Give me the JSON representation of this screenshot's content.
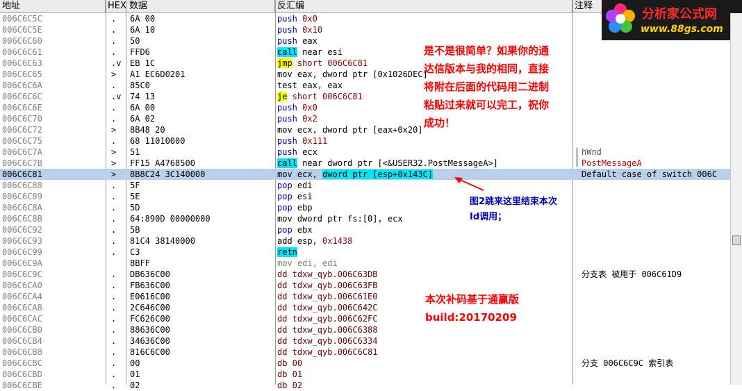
{
  "header": {
    "addr": "地址",
    "hex": "HEX 数据",
    "disasm": "反汇编",
    "comment": "注释"
  },
  "logo": {
    "title": "分析家公式网",
    "url": "www.88gs.com"
  },
  "rows": [
    {
      "addr": "006C6C5C",
      "mark": ".",
      "hex": "6A 00",
      "dis": [
        {
          "t": "push",
          "c": "kw-push"
        },
        {
          "t": " "
        },
        {
          "t": "0x0",
          "c": "imm"
        }
      ],
      "cmt": ""
    },
    {
      "addr": "006C6C5E",
      "mark": ".",
      "hex": "6A 10",
      "dis": [
        {
          "t": "push",
          "c": "kw-push"
        },
        {
          "t": " "
        },
        {
          "t": "0x10",
          "c": "imm"
        }
      ],
      "cmt": ""
    },
    {
      "addr": "006C6C60",
      "mark": ".",
      "hex": "50",
      "dis": [
        {
          "t": "push",
          "c": "kw-push"
        },
        {
          "t": " eax"
        }
      ],
      "cmt": ""
    },
    {
      "addr": "006C6C61",
      "mark": ".",
      "hex": "FFD6",
      "dis": [
        {
          "t": "call",
          "c": "kw-call"
        },
        {
          "t": " near esi"
        }
      ],
      "cmt": ""
    },
    {
      "addr": "006C6C63",
      "mark": ".v",
      "hex": "EB 1C",
      "dis": [
        {
          "t": "jmp",
          "c": "kw-jmp"
        },
        {
          "t": " short 006C6C81",
          "c": "imm"
        }
      ],
      "cmt": ""
    },
    {
      "addr": "006C6C65",
      "mark": ">",
      "hex": "A1 EC6D0201",
      "dis": [
        {
          "t": "mov eax, dword ptr [0x1026DEC]"
        }
      ],
      "cmt": ""
    },
    {
      "addr": "006C6C6A",
      "mark": ".",
      "hex": "85C0",
      "dis": [
        {
          "t": "test eax, eax"
        }
      ],
      "cmt": ""
    },
    {
      "addr": "006C6C6C",
      "mark": ".v",
      "hex": "74 13",
      "dis": [
        {
          "t": "je",
          "c": "kw-jmp"
        },
        {
          "t": " short 006C6C81",
          "c": "imm"
        }
      ],
      "cmt": ""
    },
    {
      "addr": "006C6C6E",
      "mark": ".",
      "hex": "6A 00",
      "dis": [
        {
          "t": "push",
          "c": "kw-push"
        },
        {
          "t": " "
        },
        {
          "t": "0x0",
          "c": "imm"
        }
      ],
      "cmt": ""
    },
    {
      "addr": "006C6C70",
      "mark": ".",
      "hex": "6A 02",
      "dis": [
        {
          "t": "push",
          "c": "kw-push"
        },
        {
          "t": " "
        },
        {
          "t": "0x2",
          "c": "imm"
        }
      ],
      "cmt": ""
    },
    {
      "addr": "006C6C72",
      "mark": ">",
      "hex": "8B48 20",
      "dis": [
        {
          "t": "mov ecx, dword ptr [eax+0x20]"
        }
      ],
      "cmt": ""
    },
    {
      "addr": "006C6C75",
      "mark": ".",
      "hex": "68 11010000",
      "dis": [
        {
          "t": "push",
          "c": "kw-push"
        },
        {
          "t": " "
        },
        {
          "t": "0x111",
          "c": "imm"
        }
      ],
      "cmt": ""
    },
    {
      "addr": "006C6C7A",
      "mark": ">",
      "hex": "51",
      "dis": [
        {
          "t": "push",
          "c": "kw-push"
        },
        {
          "t": " ecx"
        }
      ],
      "cmt": "hWnd",
      "cmtColor": "#555555"
    },
    {
      "addr": "006C6C7B",
      "mark": ">",
      "hex": "FF15 A4768500",
      "dis": [
        {
          "t": "call",
          "c": "kw-call"
        },
        {
          "t": " near dword ptr [<&USER32.PostMessageA>]"
        }
      ],
      "cmt": "PostMessageA",
      "cmtColor": "#cc0000"
    },
    {
      "addr": "006C6C81",
      "mark": ">",
      "hex": "8B8C24 3C140000",
      "dis": [
        {
          "t": "mov ecx, "
        },
        {
          "t": "dword ptr [esp+0x143C]",
          "c": "hl"
        }
      ],
      "cmt": "Default case of switch 006C",
      "sel": true
    },
    {
      "addr": "006C6C88",
      "mark": ".",
      "hex": "5F",
      "dis": [
        {
          "t": "pop",
          "c": "kw-pop"
        },
        {
          "t": " edi"
        }
      ],
      "cmt": ""
    },
    {
      "addr": "006C6C89",
      "mark": ".",
      "hex": "5E",
      "dis": [
        {
          "t": "pop",
          "c": "kw-pop"
        },
        {
          "t": " esi"
        }
      ],
      "cmt": ""
    },
    {
      "addr": "006C6C8A",
      "mark": ".",
      "hex": "5D",
      "dis": [
        {
          "t": "pop",
          "c": "kw-pop"
        },
        {
          "t": " ebp"
        }
      ],
      "cmt": ""
    },
    {
      "addr": "006C6C8B",
      "mark": ".",
      "hex": "64:890D 00000000",
      "dis": [
        {
          "t": "mov dword ptr fs:[0], ecx"
        }
      ],
      "cmt": ""
    },
    {
      "addr": "006C6C92",
      "mark": ".",
      "hex": "5B",
      "dis": [
        {
          "t": "pop",
          "c": "kw-pop"
        },
        {
          "t": " ebx"
        }
      ],
      "cmt": ""
    },
    {
      "addr": "006C6C93",
      "mark": ".",
      "hex": "81C4 38140000",
      "dis": [
        {
          "t": "add esp, "
        },
        {
          "t": "0x1438",
          "c": "imm"
        }
      ],
      "cmt": ""
    },
    {
      "addr": "006C6C99",
      "mark": ".",
      "hex": "C3",
      "dis": [
        {
          "t": "retn",
          "c": "kw-retn"
        }
      ],
      "cmt": ""
    },
    {
      "addr": "006C6C9A",
      "mark": "",
      "hex": "8BFF",
      "dis": [
        {
          "t": "mov edi, edi",
          "c": "kw-gray"
        }
      ],
      "cmt": ""
    },
    {
      "addr": "006C6C9C",
      "mark": ".",
      "hex": "DB636C00",
      "dis": [
        {
          "t": "dd tdxw_qyb.006C63DB",
          "c": "kw-dd"
        }
      ],
      "cmt": "分支表 被用于 006C61D9"
    },
    {
      "addr": "006C6CA0",
      "mark": ".",
      "hex": "FB636C00",
      "dis": [
        {
          "t": "dd tdxw_qyb.006C63FB",
          "c": "kw-dd"
        }
      ],
      "cmt": ""
    },
    {
      "addr": "006C6CA4",
      "mark": ".",
      "hex": "E0616C00",
      "dis": [
        {
          "t": "dd tdxw_qyb.006C61E0",
          "c": "kw-dd"
        }
      ],
      "cmt": ""
    },
    {
      "addr": "006C6CA8",
      "mark": ".",
      "hex": "2C646C00",
      "dis": [
        {
          "t": "dd tdxw_qyb.006C642C",
          "c": "kw-dd"
        }
      ],
      "cmt": ""
    },
    {
      "addr": "006C6CAC",
      "mark": ".",
      "hex": "FC626C00",
      "dis": [
        {
          "t": "dd tdxw_qyb.006C62FC",
          "c": "kw-dd"
        }
      ],
      "cmt": ""
    },
    {
      "addr": "006C6CB0",
      "mark": ".",
      "hex": "88636C00",
      "dis": [
        {
          "t": "dd tdxw_qyb.006C6388",
          "c": "kw-dd"
        }
      ],
      "cmt": ""
    },
    {
      "addr": "006C6CB4",
      "mark": ".",
      "hex": "34636C00",
      "dis": [
        {
          "t": "dd tdxw_qyb.006C6334",
          "c": "kw-dd"
        }
      ],
      "cmt": ""
    },
    {
      "addr": "006C6CB8",
      "mark": ".",
      "hex": "816C6C00",
      "dis": [
        {
          "t": "dd tdxw_qyb.006C6C81",
          "c": "kw-dd"
        }
      ],
      "cmt": ""
    },
    {
      "addr": "006C6CBC",
      "mark": ".",
      "hex": "00",
      "dis": [
        {
          "t": "db 00",
          "c": "kw-dd"
        }
      ],
      "cmt": "分支 006C6C9C 索引表"
    },
    {
      "addr": "006C6CBD",
      "mark": ".",
      "hex": "01",
      "dis": [
        {
          "t": "db 01",
          "c": "kw-dd"
        }
      ],
      "cmt": ""
    },
    {
      "addr": "006C6CBE",
      "mark": ".",
      "hex": "02",
      "dis": [
        {
          "t": "db 02",
          "c": "kw-dd"
        }
      ],
      "cmt": ""
    }
  ],
  "annotations": {
    "note1": [
      "是不是很简单？如果你的通",
      "达信版本与我的相同，直接",
      "将附在后面的代码用二进制",
      "粘贴过来就可以完工，祝你",
      "成功！"
    ],
    "note2": [
      "图2跳来这里结束本次",
      "Id调用；"
    ],
    "note3": [
      "本次补码基于通赢版",
      "build:20170209"
    ]
  }
}
